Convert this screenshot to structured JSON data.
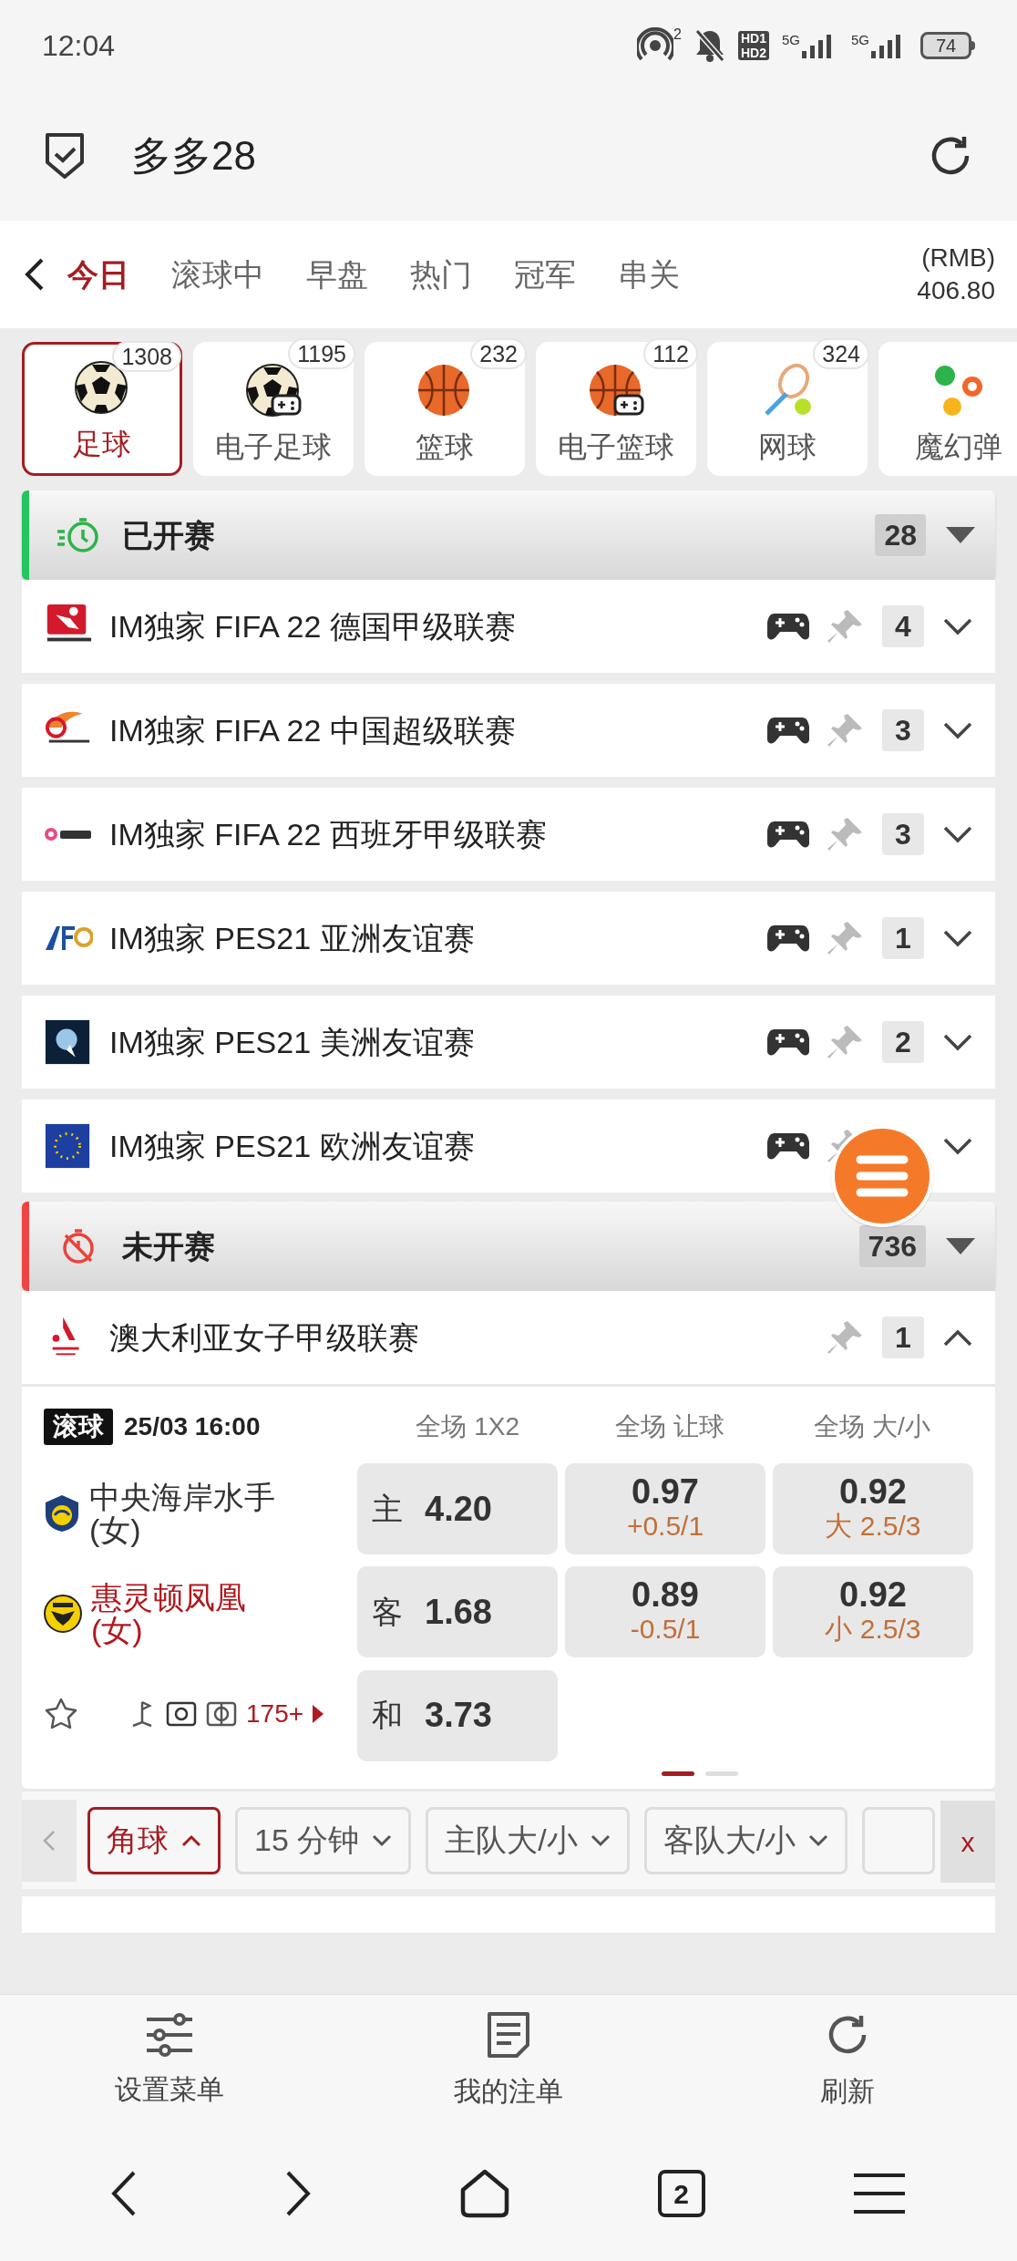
{
  "status_bar": {
    "time": "12:04",
    "hotspot_count": "2",
    "hd_top": "HD1",
    "hd_bottom": "HD2",
    "network_1": "5G",
    "network_2": "5G",
    "battery": "74"
  },
  "header": {
    "title": "多多28"
  },
  "nav": {
    "tabs": [
      {
        "label": "今日",
        "selected": true
      },
      {
        "label": "滚球中",
        "selected": false
      },
      {
        "label": "早盘",
        "selected": false
      },
      {
        "label": "热门",
        "selected": false
      },
      {
        "label": "冠军",
        "selected": false
      },
      {
        "label": "串关",
        "selected": false
      }
    ],
    "currency": "(RMB)",
    "balance": "406.80"
  },
  "sports": [
    {
      "kind": "soccer",
      "label": "足球",
      "count": "1308",
      "selected": true
    },
    {
      "kind": "esoccer",
      "label": "电子足球",
      "count": "1195",
      "selected": false
    },
    {
      "kind": "basketball",
      "label": "篮球",
      "count": "232",
      "selected": false
    },
    {
      "kind": "ebasketball",
      "label": "电子篮球",
      "count": "112",
      "selected": false
    },
    {
      "kind": "tennis",
      "label": "网球",
      "count": "324",
      "selected": false
    },
    {
      "kind": "other",
      "label": "魔幻弹",
      "selected": false
    }
  ],
  "sections": [
    {
      "kind": "live",
      "title": "已开赛",
      "count": "28",
      "color": "#22c55e",
      "leagues": [
        {
          "kind": "bundesliga",
          "name": "IM独家 FIFA 22 德国甲级联赛",
          "count": "4",
          "controller": true,
          "expanded": false
        },
        {
          "kind": "csl",
          "name": "IM独家 FIFA 22 中国超级联赛",
          "count": "3",
          "controller": true,
          "expanded": false
        },
        {
          "kind": "laliga",
          "name": "IM独家 FIFA 22 西班牙甲级联赛",
          "count": "3",
          "controller": true,
          "expanded": false
        },
        {
          "kind": "afc",
          "name": "IM独家 PES21 亚洲友谊赛",
          "count": "1",
          "controller": true,
          "expanded": false
        },
        {
          "kind": "americas",
          "name": "IM独家 PES21 美洲友谊赛",
          "count": "2",
          "controller": true,
          "expanded": false
        },
        {
          "kind": "europe",
          "name": "IM独家 PES21 欧洲友谊赛",
          "controller": true,
          "expanded": false
        }
      ]
    },
    {
      "kind": "upcoming",
      "title": "未开赛",
      "count": "736",
      "color": "#ef4444",
      "leagues": [
        {
          "kind": "aleague",
          "name": "澳大利亚女子甲级联赛",
          "count": "1",
          "controller": false,
          "expanded": true,
          "match": {
            "badge": "滚球",
            "time": "25/03 16:00",
            "columns": [
              "全场 1X2",
              "全场 让球",
              "全场 大/小"
            ],
            "teams": [
              {
                "name": "中央海岸水手(女)",
                "highlighted": false
              },
              {
                "name": "惠灵顿凤凰(女)",
                "highlighted": true
              }
            ],
            "odds_1x2": [
              {
                "label": "主",
                "value": "4.20"
              },
              {
                "label": "客",
                "value": "1.68"
              },
              {
                "label": "和",
                "value": "3.73"
              }
            ],
            "handicap": [
              {
                "value": "0.97",
                "line": "+0.5/1"
              },
              {
                "value": "0.89",
                "line": "-0.5/1"
              }
            ],
            "over_under": [
              {
                "value": "0.92",
                "line": "大 2.5/3"
              },
              {
                "value": "0.92",
                "line": "小 2.5/3"
              }
            ],
            "more_bets": "175+",
            "pages": [
              {
                "selected": true
              },
              {
                "selected": false
              }
            ]
          }
        }
      ]
    }
  ],
  "filters": {
    "chips": [
      {
        "label": "角球",
        "selected": true
      },
      {
        "label": "15 分钟",
        "selected": false
      },
      {
        "label": "主队大/小",
        "selected": false
      },
      {
        "label": "客队大/小",
        "selected": false
      },
      {
        "selected": false
      }
    ],
    "close": "x"
  },
  "toolbar": [
    {
      "kind": "settings",
      "label": "设置菜单"
    },
    {
      "kind": "bets",
      "label": "我的注单"
    },
    {
      "kind": "refresh",
      "label": "刷新"
    }
  ],
  "system_nav": {
    "tab_count": "2"
  }
}
